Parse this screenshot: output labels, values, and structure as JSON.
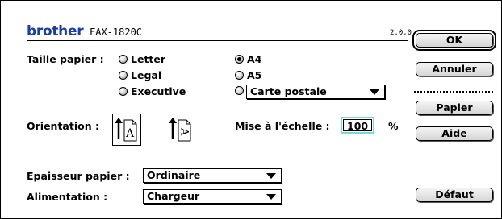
{
  "header": {
    "brand": "brother",
    "model": "FAX-1820C",
    "version": "2.0.0"
  },
  "paper_size": {
    "label": "Taille papier :",
    "options": [
      {
        "label": "Letter",
        "selected": false
      },
      {
        "label": "Legal",
        "selected": false
      },
      {
        "label": "Executive",
        "selected": false
      },
      {
        "label": "A4",
        "selected": true
      },
      {
        "label": "A5",
        "selected": false
      },
      {
        "label": "",
        "selected": false
      }
    ],
    "custom_value": "Carte postale"
  },
  "orientation": {
    "label": "Orientation :",
    "options": [
      {
        "name": "portrait",
        "selected": true
      },
      {
        "name": "landscape",
        "selected": false
      }
    ]
  },
  "scale": {
    "label": "Mise à l'échelle :",
    "value": "100",
    "unit": "%"
  },
  "thickness": {
    "label": "Epaisseur papier :",
    "value": "Ordinaire"
  },
  "feed": {
    "label": "Alimentation :",
    "value": "Chargeur"
  },
  "buttons": {
    "ok": "OK",
    "cancel": "Annuler",
    "paper": "Papier",
    "help": "Aide",
    "default": "Défaut"
  },
  "colors": {
    "brand": "#1c3f9e",
    "focus": "#7ad7df"
  },
  "icons": [
    "orientation-portrait-icon",
    "orientation-landscape-icon",
    "popup-arrow-icon"
  ]
}
